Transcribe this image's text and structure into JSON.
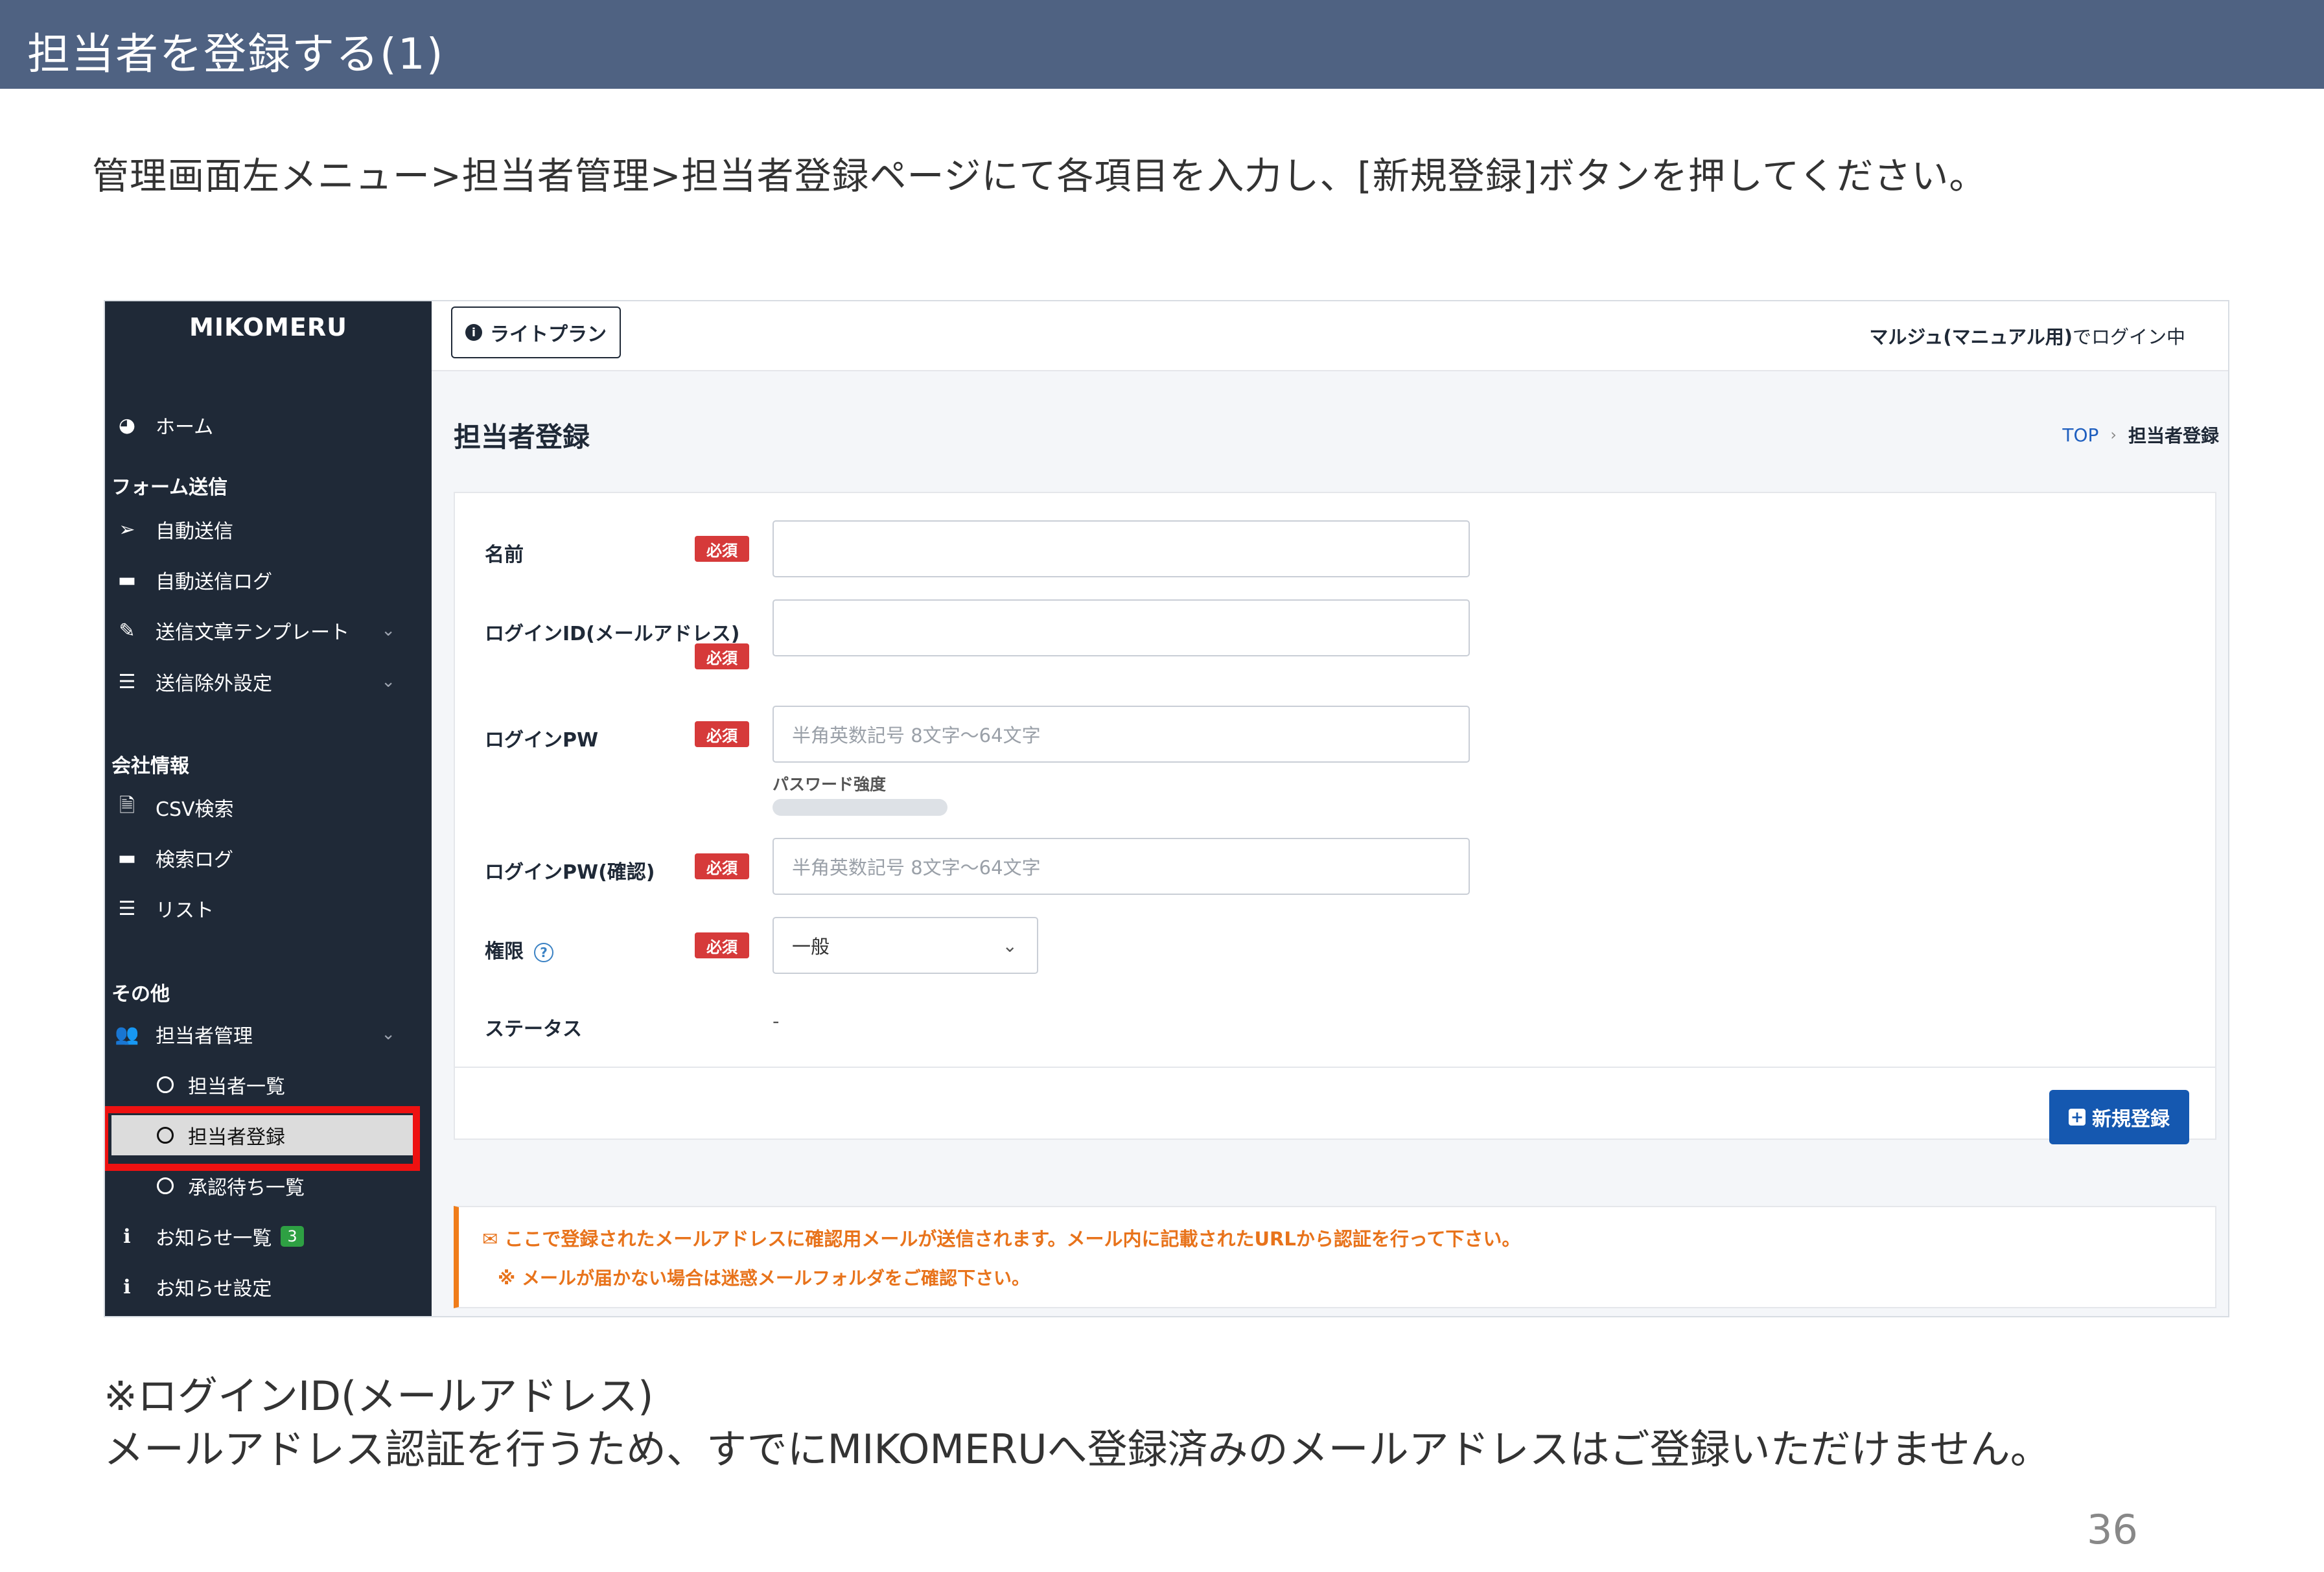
{
  "slide": {
    "title": "担当者を登録する(1)",
    "instruction": "管理画面左メニュー>担当者管理>担当者登録ページにて各項目を入力し、[新規登録]ボタンを押してください。",
    "footnote_line1": "※ログインID(メールアドレス)",
    "footnote_line2": "メールアドレス認証を行うため、すでにMIKOMERUへ登録済みのメールアドレスはご登録いただけません。",
    "page_number": "36",
    "header_color": "#4f6282",
    "highlight_color": "#ee1111"
  },
  "sidebar": {
    "brand": "MIKOMERU",
    "home": "ホーム",
    "section_form": "フォーム送信",
    "auto_send": "自動送信",
    "auto_send_log": "自動送信ログ",
    "template": "送信文章テンプレート",
    "exclusion": "送信除外設定",
    "section_company": "会社情報",
    "csv_search": "CSV検索",
    "search_log": "検索ログ",
    "list": "リスト",
    "section_other": "その他",
    "staff_mgmt": "担当者管理",
    "staff_list": "担当者一覧",
    "staff_register": "担当者登録",
    "pending": "承認待ち一覧",
    "notices": "お知らせ一覧",
    "notices_badge": "3",
    "notice_settings": "お知らせ設定"
  },
  "topbar": {
    "plan": "ライトプラン",
    "user": "マルジュ(マニュアル用)",
    "login_suffix": "でログイン中"
  },
  "page": {
    "heading": "担当者登録",
    "breadcrumb_top": "TOP",
    "breadcrumb_current": "担当者登録"
  },
  "form": {
    "required": "必須",
    "name_label": "名前",
    "name_value": "",
    "login_id_label": "ログインID(メールアドレス)",
    "login_id_value": "",
    "pw_label": "ログインPW",
    "pw_placeholder": "半角英数記号 8文字～64文字",
    "strength_label": "パスワード強度",
    "strength_level": 0,
    "pw_confirm_label": "ログインPW(確認)",
    "pw_confirm_placeholder": "半角英数記号 8文字～64文字",
    "role_label": "権限",
    "role_value": "一般",
    "status_label": "ステータス",
    "status_value": "-",
    "submit": "新規登録"
  },
  "notice": {
    "line1": "ここで登録されたメールアドレスに確認用メールが送信されます。メール内に記載されたURLから認証を行って下さい。",
    "line2": "※ メールが届かない場合は迷惑メールフォルダをご確認下さい。",
    "accent_color": "#f07d1a"
  }
}
